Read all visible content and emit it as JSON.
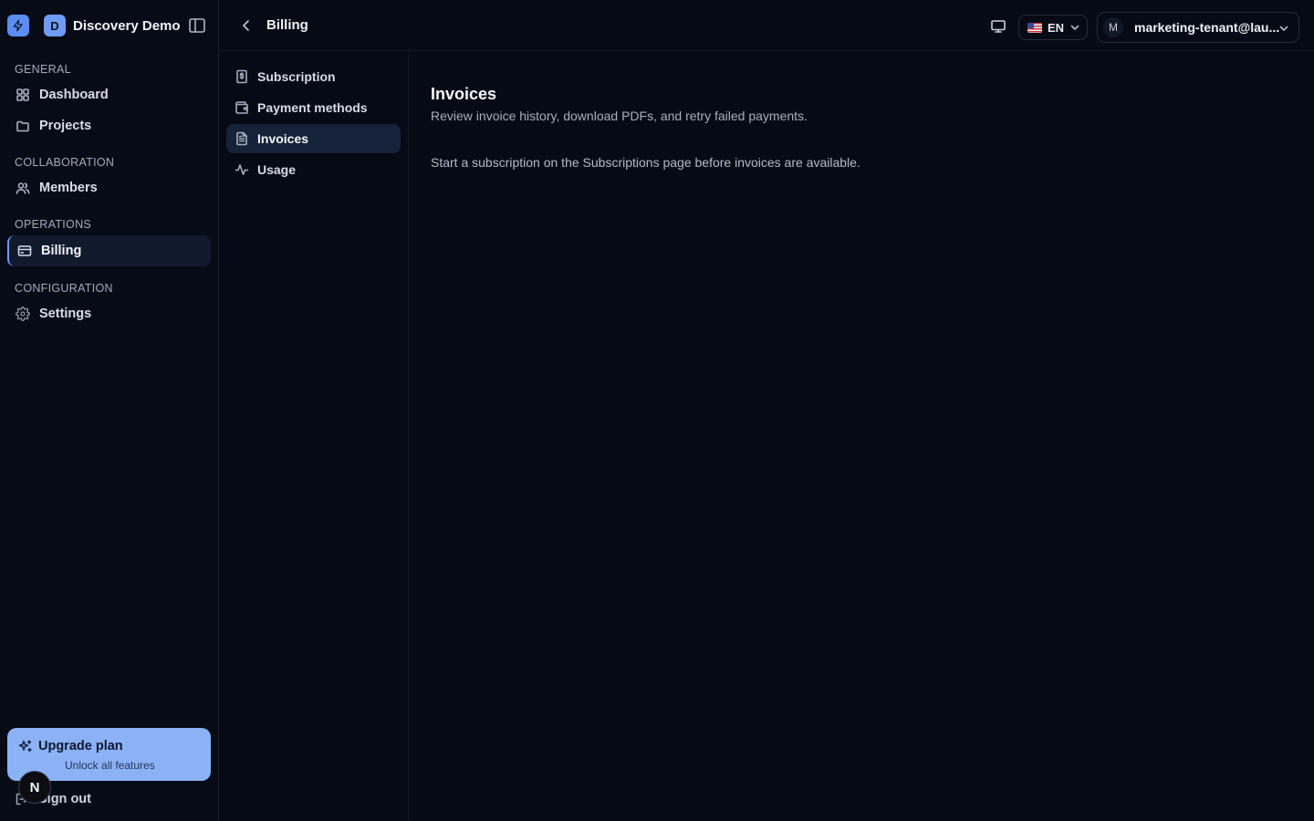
{
  "sidebar": {
    "org_initial": "D",
    "org_name": "Discovery Demo",
    "sections": [
      {
        "label": "GENERAL",
        "items": [
          {
            "label": "Dashboard",
            "icon": "grid-icon"
          },
          {
            "label": "Projects",
            "icon": "folder-icon"
          }
        ]
      },
      {
        "label": "COLLABORATION",
        "items": [
          {
            "label": "Members",
            "icon": "users-icon"
          }
        ]
      },
      {
        "label": "OPERATIONS",
        "items": [
          {
            "label": "Billing",
            "icon": "credit-card-icon",
            "active": true
          }
        ]
      },
      {
        "label": "CONFIGURATION",
        "items": [
          {
            "label": "Settings",
            "icon": "gear-icon"
          }
        ]
      }
    ],
    "upgrade": {
      "title": "Upgrade plan",
      "subtitle": "Unlock all features"
    },
    "signout": "Sign out",
    "badge": "N"
  },
  "topbar": {
    "breadcrumb": "Billing",
    "language": "EN",
    "user_initial": "M",
    "user_email": "marketing-tenant@lau..."
  },
  "subnav": {
    "items": [
      {
        "label": "Subscription",
        "icon": "dollar-doc-icon"
      },
      {
        "label": "Payment methods",
        "icon": "wallet-icon"
      },
      {
        "label": "Invoices",
        "icon": "invoice-icon",
        "active": true
      },
      {
        "label": "Usage",
        "icon": "activity-icon"
      }
    ]
  },
  "main": {
    "title": "Invoices",
    "subtitle": "Review invoice history, download PDFs, and retry failed payments.",
    "empty_message": "Start a subscription on the Subscriptions page before invoices are available."
  },
  "colors": {
    "background": "#060a14",
    "accent": "#6e9cf5",
    "upgrade_bg": "#8cb2f6",
    "active_item_bg": "#111a2d"
  }
}
